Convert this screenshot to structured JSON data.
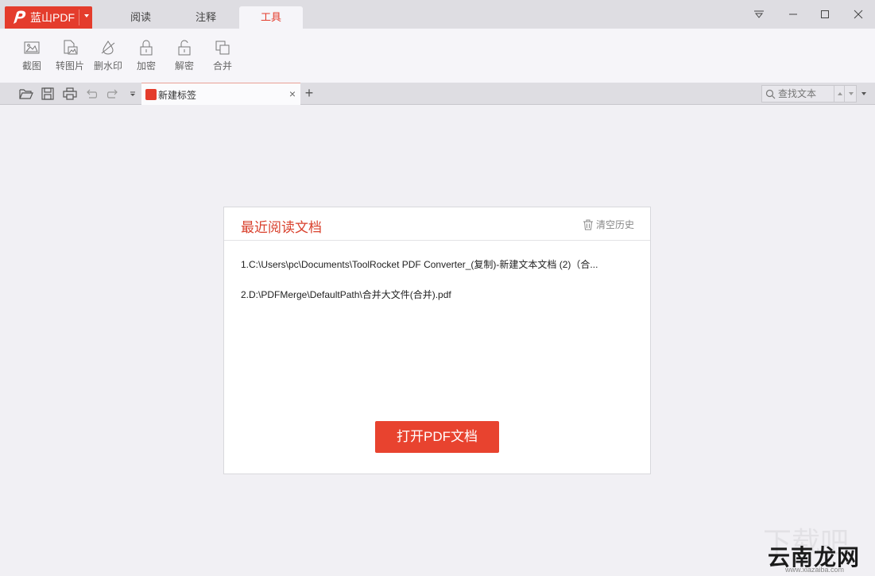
{
  "app": {
    "name": "蓝山PDF",
    "accent_color": "#e43c2c"
  },
  "tabs": [
    {
      "label": "阅读",
      "active": false
    },
    {
      "label": "注释",
      "active": false
    },
    {
      "label": "工具",
      "active": true
    }
  ],
  "window_controls": [
    "menu-icon",
    "minimize-icon",
    "maximize-icon",
    "close-icon"
  ],
  "ribbon": {
    "tools": [
      {
        "label": "截图",
        "icon": "screenshot-icon"
      },
      {
        "label": "转图片",
        "icon": "to-image-icon"
      },
      {
        "label": "删水印",
        "icon": "remove-watermark-icon"
      },
      {
        "label": "加密",
        "icon": "lock-icon"
      },
      {
        "label": "解密",
        "icon": "unlock-icon"
      },
      {
        "label": "合并",
        "icon": "merge-icon"
      }
    ]
  },
  "quick_access": [
    "open-folder-icon",
    "save-icon",
    "print-icon",
    "undo-icon",
    "redo-icon",
    "customize-dropdown-icon"
  ],
  "doc_tab": {
    "label": "新建标签",
    "close": "×",
    "new_tab": "+"
  },
  "search": {
    "placeholder": "查找文本"
  },
  "recent_panel": {
    "title": "最近阅读文档",
    "clear_label": "清空历史",
    "items": [
      "1.C:\\Users\\pc\\Documents\\ToolRocket PDF Converter_(复制)-新建文本文档 (2)（合...",
      "2.D:\\PDFMerge\\DefaultPath\\合并大文件(合并).pdf"
    ],
    "open_button": "打开PDF文档"
  },
  "watermark": {
    "text": "云南龙网",
    "subtext": "www.xiazaiba.com",
    "ghost": "下载吧"
  }
}
